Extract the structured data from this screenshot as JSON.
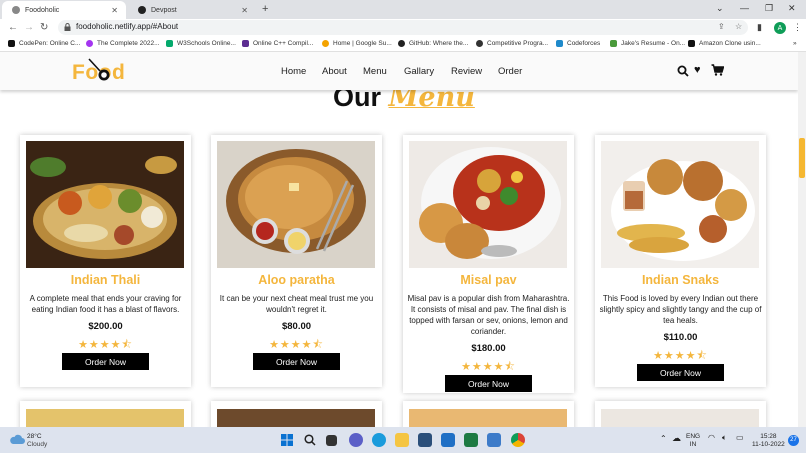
{
  "browser": {
    "tabs": [
      {
        "title": "Foodoholic",
        "active": true
      },
      {
        "title": "Devpost",
        "active": false
      }
    ],
    "new_tab": "+",
    "url": "foodoholic.netlify.app/#About",
    "profile_initial": "A",
    "bookmarks": [
      "CodePen: Online C...",
      "The Complete 2022...",
      "W3Schools Online...",
      "Online C++ Compil...",
      "Home | Google Su...",
      "GitHub: Where the...",
      "Competitive Progra...",
      "Codeforces",
      "Jake's Resume - On...",
      "Amazon Clone usin..."
    ]
  },
  "site": {
    "logo": "Food",
    "nav": [
      "Home",
      "About",
      "Menu",
      "Gallary",
      "Review",
      "Order"
    ],
    "section_title_plain": "Our",
    "section_title_script": "Menu",
    "cards": [
      {
        "name": "Indian Thali",
        "desc": "A complete meal that ends your craving for eating Indian food it has a blast of flavors.",
        "price": "$200.00",
        "stars": "★★★★⯪",
        "button": "Order Now"
      },
      {
        "name": "Aloo paratha",
        "desc": "It can be your next cheat meal trust me you wouldn't regret it.",
        "price": "$80.00",
        "stars": "★★★★⯪",
        "button": "Order Now"
      },
      {
        "name": "Misal pav",
        "desc": "Misal pav is a popular dish from Maharashtra. It consists of misal and pav. The final dish is topped with farsan or sev, onions, lemon and coriander.",
        "price": "$180.00",
        "stars": "★★★★⯪",
        "button": "Order Now"
      },
      {
        "name": "Indian Snaks",
        "desc": "This Food is loved by every Indian out there slightly spicy and slightly tangy and the cup of tea heals.",
        "price": "$110.00",
        "stars": "★★★★⯪",
        "button": "Order Now"
      }
    ]
  },
  "taskbar": {
    "temperature": "28°C",
    "weather": "Cloudy",
    "lang_top": "ENG",
    "lang_bottom": "IN",
    "time": "15:28",
    "date": "11-10-2022",
    "notifications": "27"
  },
  "colors": {
    "accent": "#f4b63d",
    "button": "#000000"
  }
}
